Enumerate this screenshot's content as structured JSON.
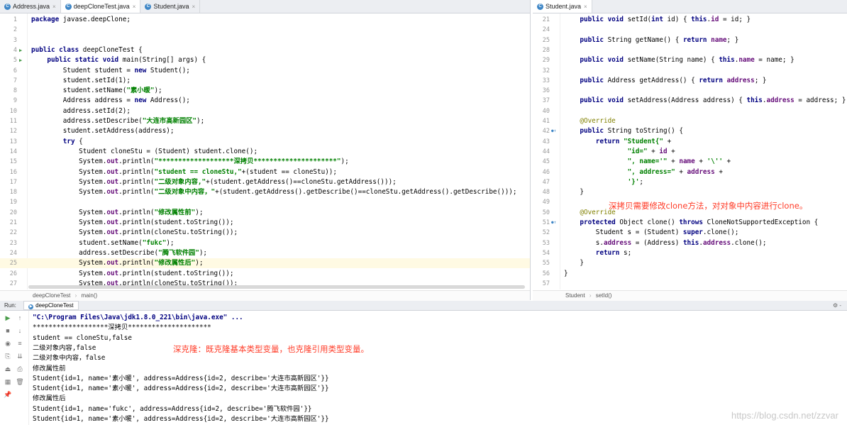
{
  "left_pane": {
    "tabs": [
      {
        "label": "Address.java",
        "active": false
      },
      {
        "label": "deepCloneTest.java",
        "active": true
      },
      {
        "label": "Student.java",
        "active": false
      }
    ],
    "lines": [
      {
        "n": "1",
        "html": "<span class=\"kw\">package</span> javase.deepClone;"
      },
      {
        "n": "2",
        "html": ""
      },
      {
        "n": "3",
        "html": ""
      },
      {
        "n": "4",
        "run": true,
        "html": "<span class=\"kw\">public class</span> deepCloneTest {"
      },
      {
        "n": "5",
        "run": true,
        "html": "    <span class=\"kw\">public static void</span> main(String[] args) {"
      },
      {
        "n": "6",
        "html": "        Student student = <span class=\"kw\">new</span> Student();"
      },
      {
        "n": "7",
        "html": "        student.setId(1);"
      },
      {
        "n": "8",
        "html": "        student.setName(<span class=\"str\">\"素小暖\"</span>);"
      },
      {
        "n": "9",
        "html": "        Address address = <span class=\"kw\">new</span> Address();"
      },
      {
        "n": "10",
        "html": "        address.setId(2);"
      },
      {
        "n": "11",
        "html": "        address.setDescribe(<span class=\"str\">\"大连市高新园区\"</span>);"
      },
      {
        "n": "12",
        "html": "        student.setAddress(address);"
      },
      {
        "n": "13",
        "html": "        <span class=\"kw\">try</span> {"
      },
      {
        "n": "14",
        "html": "            Student cloneStu = (Student) student.clone();"
      },
      {
        "n": "15",
        "html": "            System.<span class=\"fld\">out</span>.println(<span class=\"str\">\"*******************深拷贝*********************\"</span>);"
      },
      {
        "n": "16",
        "html": "            System.<span class=\"fld\">out</span>.println(<span class=\"str\">\"student == cloneStu,\"</span>+(student == cloneStu));"
      },
      {
        "n": "17",
        "html": "            System.<span class=\"fld\">out</span>.println(<span class=\"str\">\"二级对象内容,\"</span>+(student.getAddress()==cloneStu.getAddress()));"
      },
      {
        "n": "18",
        "html": "            System.<span class=\"fld\">out</span>.println(<span class=\"str\">\"二级对象中内容，\"</span>+(student.getAddress().getDescribe()==cloneStu.getAddress().getDescribe()));"
      },
      {
        "n": "19",
        "html": ""
      },
      {
        "n": "20",
        "html": "            System.<span class=\"fld\">out</span>.println(<span class=\"str\">\"修改属性前\"</span>);"
      },
      {
        "n": "21",
        "html": "            System.<span class=\"fld\">out</span>.println(student.toString());"
      },
      {
        "n": "22",
        "html": "            System.<span class=\"fld\">out</span>.println(cloneStu.toString());"
      },
      {
        "n": "23",
        "html": "            student.setName(<span class=\"str\">\"fukc\"</span>);"
      },
      {
        "n": "24",
        "html": "            address.setDescribe(<span class=\"str\">\"腾飞软件园\"</span>);"
      },
      {
        "n": "25",
        "hl": true,
        "html": "            System.<span class=\"fld\">out</span>.println(<span class=\"str\">\"修改属性后\"</span>);"
      },
      {
        "n": "26",
        "html": "            System.<span class=\"fld\">out</span>.println(student.toString());"
      },
      {
        "n": "27",
        "html": "            System.<span class=\"fld\">out</span>.println(cloneStu.toString());"
      }
    ],
    "breadcrumb": [
      "deepCloneTest",
      "main()"
    ]
  },
  "right_pane": {
    "tabs": [
      {
        "label": "Student.java",
        "active": true
      }
    ],
    "lines": [
      {
        "n": "21",
        "html": "    <span class=\"kw\">public void</span> setId(<span class=\"kw\">int</span> id) { <span class=\"kw\">this</span>.<span class=\"fld\">id</span> = id; }"
      },
      {
        "n": "24",
        "html": ""
      },
      {
        "n": "25",
        "html": "    <span class=\"kw\">public</span> String getName() { <span class=\"kw\">return</span> <span class=\"fld\">name</span>; }"
      },
      {
        "n": "28",
        "html": ""
      },
      {
        "n": "29",
        "html": "    <span class=\"kw\">public void</span> setName(String name) { <span class=\"kw\">this</span>.<span class=\"fld\">name</span> = name; }"
      },
      {
        "n": "32",
        "html": ""
      },
      {
        "n": "33",
        "html": "    <span class=\"kw\">public</span> Address getAddress() { <span class=\"kw\">return</span> <span class=\"fld\">address</span>; }"
      },
      {
        "n": "36",
        "html": ""
      },
      {
        "n": "37",
        "html": "    <span class=\"kw\">public void</span> setAddress(Address address) { <span class=\"kw\">this</span>.<span class=\"fld\">address</span> = address; }"
      },
      {
        "n": "40",
        "html": ""
      },
      {
        "n": "41",
        "html": "    <span class=\"ann\">@Override</span>"
      },
      {
        "n": "42",
        "ov": true,
        "html": "    <span class=\"kw\">public</span> String toString() {"
      },
      {
        "n": "43",
        "html": "        <span class=\"kw\">return</span> <span class=\"str\">\"Student{\"</span> +"
      },
      {
        "n": "44",
        "html": "                <span class=\"str\">\"id=\"</span> + <span class=\"fld\">id</span> +"
      },
      {
        "n": "45",
        "html": "                <span class=\"str\">\", name='\"</span> + <span class=\"fld\">name</span> + <span class=\"str\">'\\''</span> +"
      },
      {
        "n": "46",
        "html": "                <span class=\"str\">\", address=\"</span> + <span class=\"fld\">address</span> +"
      },
      {
        "n": "47",
        "html": "                <span class=\"str\">'}'</span>;"
      },
      {
        "n": "48",
        "html": "    }"
      },
      {
        "n": "49",
        "html": ""
      },
      {
        "n": "50",
        "html": "    <span class=\"ann\">@Override</span>"
      },
      {
        "n": "51",
        "ov": true,
        "html": "    <span class=\"kw\">protected</span> Object clone() <span class=\"kw\">throws</span> CloneNotSupportedException {"
      },
      {
        "n": "52",
        "html": "        Student s = (Student) <span class=\"kw\">super</span>.clone();"
      },
      {
        "n": "53",
        "html": "        s.<span class=\"fld\">address</span> = (Address) <span class=\"kw\">this</span>.<span class=\"fld\">address</span>.clone();"
      },
      {
        "n": "54",
        "html": "        <span class=\"kw\">return</span> s;"
      },
      {
        "n": "55",
        "html": "    }"
      },
      {
        "n": "56",
        "html": "}"
      },
      {
        "n": "57",
        "html": ""
      }
    ],
    "breadcrumb": [
      "Student",
      "setId()"
    ]
  },
  "annotations": {
    "right_note": "深拷贝需要修改clone方法，对对象中内容进行clone。",
    "console_note": "深克隆：既克隆基本类型变量，也克隆引用类型变量。"
  },
  "run_panel": {
    "label": "Run:",
    "tab": "deepCloneTest",
    "lines": [
      {
        "text": "\"C:\\Program Files\\Java\\jdk1.8.0_221\\bin\\java.exe\" ...",
        "cmd": true
      },
      {
        "text": "*******************深拷贝*********************"
      },
      {
        "text": "student == cloneStu,false"
      },
      {
        "text": "二级对象内容,false"
      },
      {
        "text": "二级对象中内容，false"
      },
      {
        "text": "修改属性前"
      },
      {
        "text": "Student{id=1, name='素小暖', address=Address{id=2, describe='大连市高新园区'}}"
      },
      {
        "text": "Student{id=1, name='素小暖', address=Address{id=2, describe='大连市高新园区'}}"
      },
      {
        "text": "修改属性后"
      },
      {
        "text": "Student{id=1, name='fukc', address=Address{id=2, describe='腾飞软件园'}}"
      },
      {
        "text": "Student{id=1, name='素小暖', address=Address{id=2, describe='大连市高新园区'}}"
      }
    ]
  },
  "watermark": "https://blog.csdn.net/zzvar",
  "colors": {
    "keyword": "#000080",
    "string": "#008000",
    "field": "#660e7a",
    "annotation": "#808000",
    "note": "#ff3c28"
  }
}
